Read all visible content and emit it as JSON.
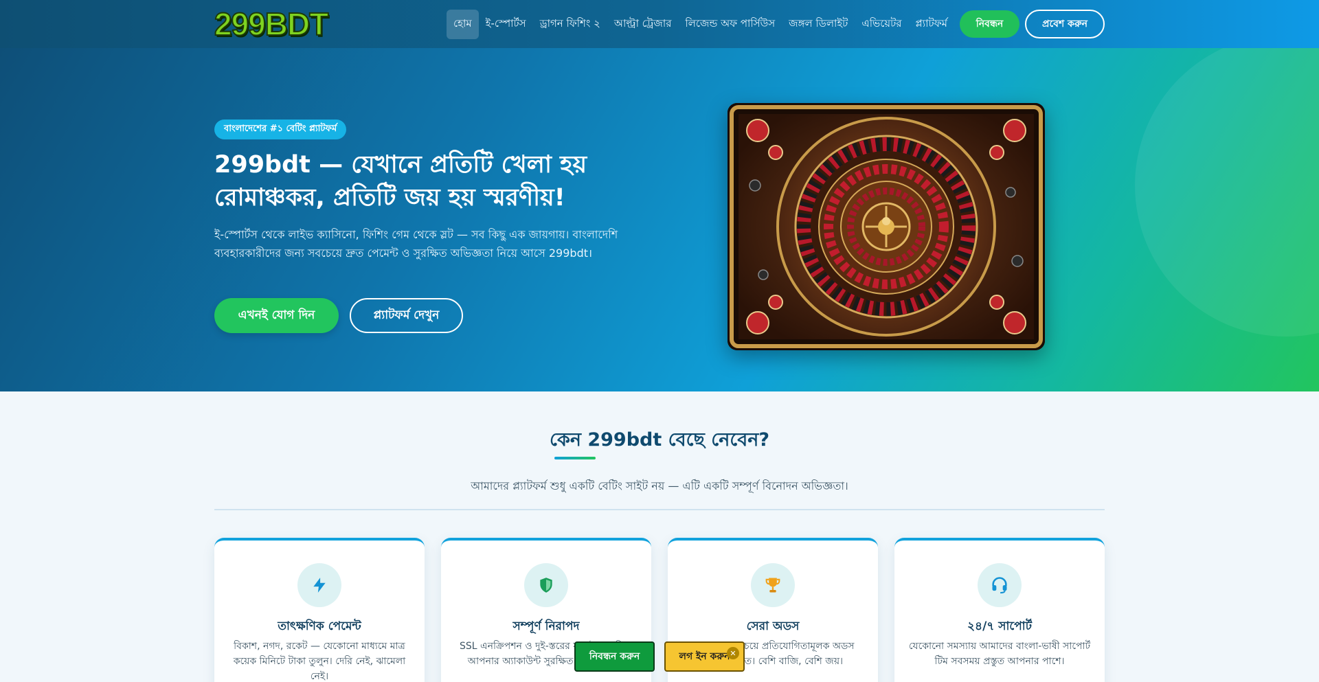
{
  "brand": {
    "logo_text": "299BDT"
  },
  "nav": {
    "items": [
      {
        "label": "হোম",
        "active": true
      },
      {
        "label": "ই-স্পোর্টস"
      },
      {
        "label": "ড্রাগন ফিশিং ২"
      },
      {
        "label": "আল্ট্রা ট্রেজার"
      },
      {
        "label": "লিজেন্ড অফ পার্সিউস"
      },
      {
        "label": "জঙ্গল ডিলাইট"
      },
      {
        "label": "এভিয়েটর"
      },
      {
        "label": "প্ল্যাটফর্ম"
      }
    ],
    "register_label": "নিবন্ধন",
    "login_label": "প্রবেশ করুন"
  },
  "hero": {
    "badge": "বাংলাদেশের #১ বেটিং প্ল্যাটফর্ম",
    "title": "299bdt — যেখানে প্রতিটি খেলা হয় রোমাঞ্চকর, প্রতিটি জয় হয় স্মরণীয়!",
    "description": "ই-স্পোর্টস থেকে লাইভ ক্যাসিনো, ফিশিং গেম থেকে স্লট — সব কিছু এক জায়গায়। বাংলাদেশি ব্যবহারকারীদের জন্য সবচেয়ে দ্রুত পেমেন্ট ও সুরক্ষিত অভিজ্ঞতা নিয়ে আসে 299bdt।",
    "join_label": "এখনই যোগ দিন",
    "platform_label": "প্ল্যাটফর্ম দেখুন",
    "image_icon": "roulette-wheel-image"
  },
  "why": {
    "title": "কেন 299bdt বেছে নেবেন?",
    "subtitle": "আমাদের প্ল্যাটফর্ম শুধু একটি বেটিং সাইট নয় — এটি একটি সম্পূর্ণ বিনোদন অভিজ্ঞতা।",
    "cards": [
      {
        "icon": "lightning-icon",
        "title": "তাৎক্ষণিক পেমেন্ট",
        "text": "বিকাশ, নগদ, রকেট — যেকোনো মাধ্যমে মাত্র কয়েক মিনিটে টাকা তুলুন। দেরি নেই, ঝামেলা নেই।"
      },
      {
        "icon": "shield-icon",
        "title": "সম্পূর্ণ নিরাপদ",
        "text": "SSL এনক্রিপশন ও দুই-স্তরের যাচাইকরণ দিয়ে আপনার অ্যাকাউন্ট সুরক্ষিত রাখি আমরা।"
      },
      {
        "icon": "trophy-icon",
        "title": "সেরা অডস",
        "text": "বাজারের সবচেয়ে প্রতিযোগিতামূলক অডস 299bdt-তে। বেশি বাজি, বেশি জয়।"
      },
      {
        "icon": "headset-icon",
        "title": "২৪/৭ সাপোর্ট",
        "text": "যেকোনো সমস্যায় আমাদের বাংলা-ভাষী সাপোর্ট টিম সবসময় প্রস্তুত আপনার পাশে।"
      }
    ]
  },
  "sticky": {
    "register_label": "নিবন্ধন করুন",
    "login_label": "লগ ইন করুন",
    "close_glyph": "✕"
  },
  "colors": {
    "accent_green": "#22c55e",
    "accent_blue": "#12a2dc",
    "nav_dark": "#0e4f73",
    "sticky_yellow": "#f6c531"
  }
}
